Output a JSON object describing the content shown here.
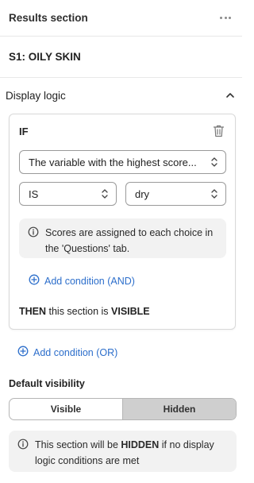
{
  "header": {
    "title": "Results section",
    "more_icon": "ellipsis-horizontal"
  },
  "section": {
    "name": "S1: OILY SKIN"
  },
  "display_logic": {
    "title": "Display logic",
    "collapse_icon": "chevron-up",
    "condition": {
      "keyword": "IF",
      "delete_icon": "trash",
      "variable_select": "The variable with the highest score...",
      "operator_select": "IS",
      "value_select": "dry",
      "info_text": "Scores are assigned to each choice in the 'Questions' tab.",
      "add_and_label": "Add condition (AND)",
      "then_keyword": "THEN",
      "then_middle": " this section is ",
      "then_state": "VISIBLE"
    },
    "add_or_label": "Add condition (OR)"
  },
  "default_visibility": {
    "label": "Default visibility",
    "options": [
      "Visible",
      "Hidden"
    ],
    "selected": "Hidden",
    "note_prefix": "This section will be ",
    "note_state": "HIDDEN",
    "note_suffix": " if no display logic conditions are met"
  },
  "colors": {
    "link": "#2c6ecb",
    "toggle_active": "#cfcfcf",
    "info_bg": "#f2f2f2"
  }
}
